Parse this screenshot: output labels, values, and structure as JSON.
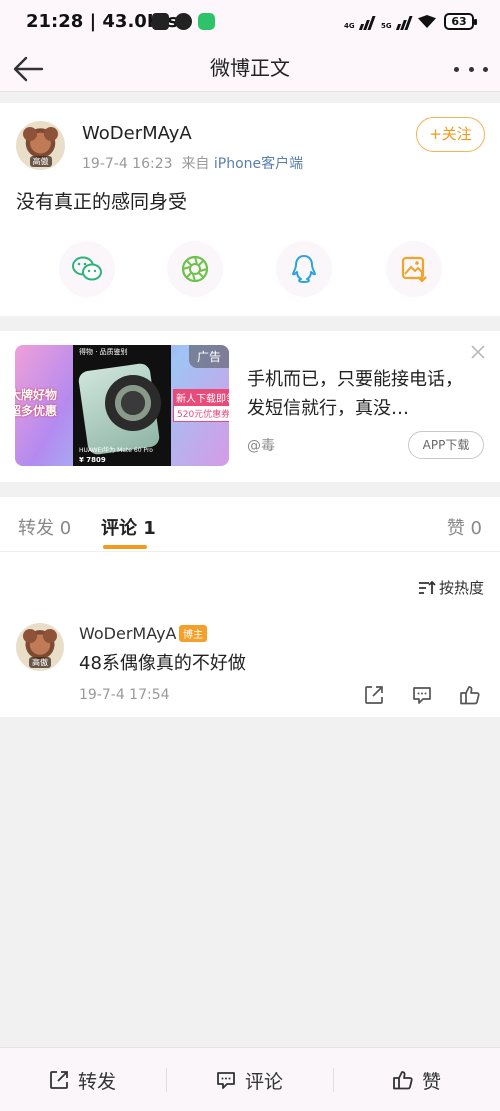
{
  "status_bar": {
    "time": "21:28",
    "speed": "43.0K/s",
    "net1": "4G",
    "net2": "5G",
    "battery": "63"
  },
  "nav": {
    "title": "微博正文"
  },
  "post": {
    "author": "WoDerMAyA",
    "avatar_tag": "高傲",
    "date": "19-7-4 16:23",
    "source_prefix": "来自",
    "source": "iPhone客户端",
    "follow_label": "+关注",
    "text": "没有真正的感同身受"
  },
  "share_icons": [
    "wechat-icon",
    "moments-icon",
    "qq-icon",
    "save-image-icon"
  ],
  "ad": {
    "tag": "广告",
    "text": "手机而已，只要能接电话，发短信就行，真没…",
    "source": "@毒",
    "download_label": "APP下载",
    "image": {
      "left_text": "大牌好物 超多优惠",
      "right_text1": "新人下载即领",
      "right_text2": "520元优惠券",
      "phone_header": "得物 · 品质鉴别",
      "phone_model": "HUAWEI华为 Mate 60 Pro",
      "phone_price": "¥ 7809"
    }
  },
  "tabs": {
    "repost": "转发 0",
    "comment": "评论 1",
    "like": "赞 0"
  },
  "comments": {
    "sort_label": "按热度",
    "items": [
      {
        "author": "WoDerMAyA",
        "badge": "博主",
        "avatar_tag": "高傲",
        "text": "48系偶像真的不好做",
        "time": "19-7-4 17:54"
      }
    ]
  },
  "bottom_bar": {
    "repost": "转发",
    "comment": "评论",
    "like": "赞"
  },
  "colors": {
    "accent": "#f29b1c",
    "link": "#5a7fb0",
    "background": "#f1f1f1"
  }
}
